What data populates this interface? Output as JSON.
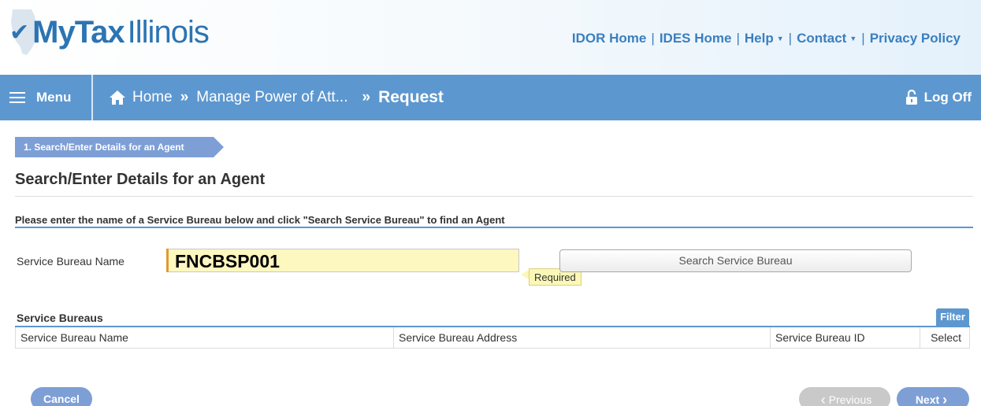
{
  "header": {
    "logo_my": "MyTax",
    "logo_state": "Illinois",
    "links": [
      {
        "label": "IDOR Home"
      },
      {
        "label": "IDES Home"
      },
      {
        "label": "Help"
      },
      {
        "label": "Contact"
      },
      {
        "label": "Privacy Policy"
      }
    ]
  },
  "nav": {
    "menu_label": "Menu",
    "breadcrumb": [
      "Home",
      "Manage Power of Att...",
      "Request"
    ],
    "breadcrumb_sep": "»",
    "logoff_label": "Log Off"
  },
  "step": {
    "label": "1. Search/Enter Details for an Agent"
  },
  "page": {
    "title": "Search/Enter Details for an Agent",
    "instructions": "Please enter the name of a Service Bureau below and click \"Search Service Bureau\" to find an Agent"
  },
  "form": {
    "field_label": "Service Bureau Name",
    "field_value": "FNCBSP001",
    "required_tip": "Required",
    "search_button": "Search Service Bureau"
  },
  "table": {
    "title": "Service Bureaus",
    "filter_label": "Filter",
    "columns": [
      "Service Bureau Name",
      "Service Bureau Address",
      "Service Bureau ID",
      "Select"
    ]
  },
  "footer": {
    "cancel_label": "Cancel",
    "previous_label": "Previous",
    "next_label": "Next"
  },
  "colors": {
    "nav_bar": "#5d97cf",
    "brand_blue": "#2c74b3",
    "input_highlight": "#fdf7c0",
    "button_blue": "#7d9fd6",
    "button_disabled": "#c9c9c9"
  }
}
